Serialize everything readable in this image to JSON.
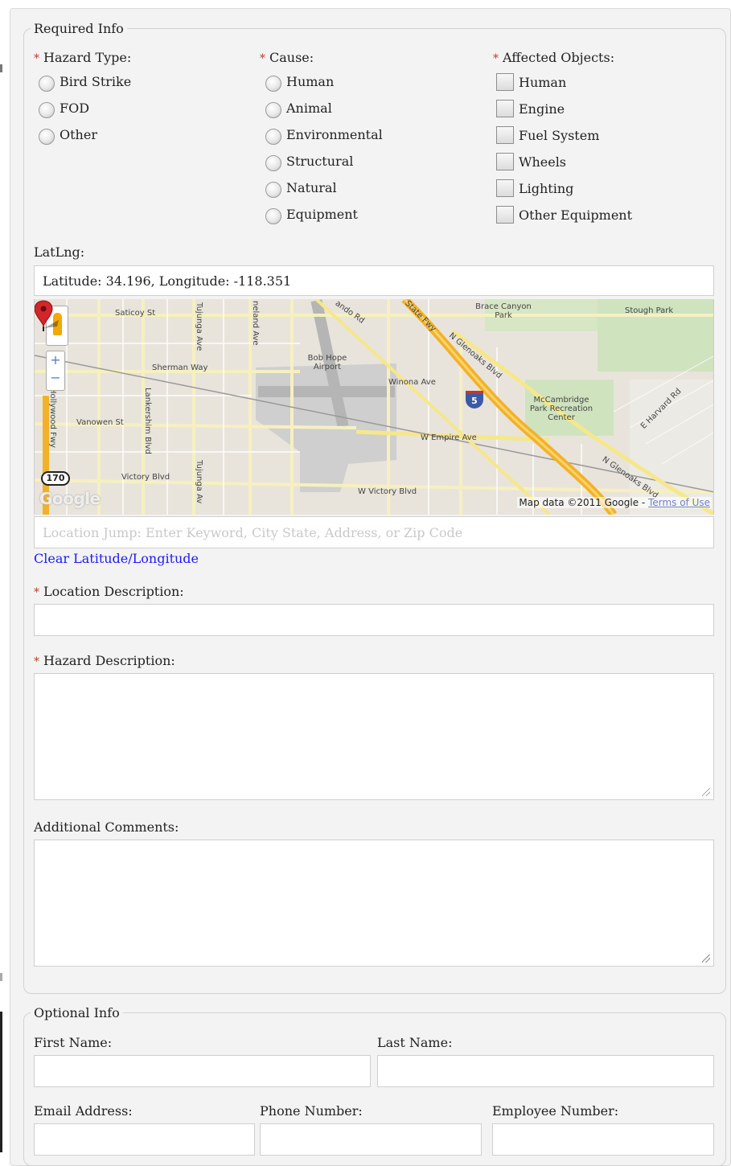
{
  "required": {
    "legend": "Required Info",
    "hazard_type": {
      "label": "Hazard Type:",
      "options": [
        "Bird Strike",
        "FOD",
        "Other"
      ]
    },
    "cause": {
      "label": "Cause:",
      "options": [
        "Human",
        "Animal",
        "Environmental",
        "Structural",
        "Natural",
        "Equipment"
      ]
    },
    "affected_objects": {
      "label": "Affected Objects:",
      "options": [
        "Human",
        "Engine",
        "Fuel System",
        "Wheels",
        "Lighting",
        "Other Equipment"
      ]
    },
    "latlng": {
      "label": "LatLng:",
      "value": "Latitude: 34.196, Longitude: -118.351"
    },
    "map": {
      "labels": {
        "saticoy": "Saticoy St",
        "sherman": "Sherman Way",
        "vanowen": "Vanowen St",
        "victory": "Victory Blvd",
        "w_victory": "W Victory Blvd",
        "w_empire": "W Empire Ave",
        "winona": "Winona Ave",
        "airport": "Bob Hope Airport",
        "mccambridge": "McCambridge Park Recreation Center",
        "brace": "Brace Canyon Park",
        "stough": "Stough Park",
        "glenoaks_n": "N Glenoaks Blvd",
        "glenoaks_n2": "N Glenoaks Blvd",
        "harvard": "E Harvard Rd",
        "state_fwy": "State Fwy",
        "lankershim": "Lankershim Blvd",
        "tujunga": "Tujunga Ave",
        "tujunga2": "Tujunga Av",
        "hollywood": "Hollywood Fwy",
        "cleveland": "neland Ave",
        "fernando": "ando Rd",
        "hwy170": "170",
        "i5": "5",
        "google": "Google"
      },
      "attribution": "Map data ©2011 Google - ",
      "terms": "Terms of Use"
    },
    "location_jump": {
      "placeholder": "Location Jump: Enter Keyword, City State, Address, or Zip Code"
    },
    "clear_link": "Clear Latitude/Longitude",
    "location_description": {
      "label": "Location Description:",
      "value": ""
    },
    "hazard_description": {
      "label": "Hazard Description:",
      "value": ""
    },
    "additional_comments": {
      "label": "Additional Comments:",
      "value": ""
    }
  },
  "optional": {
    "legend": "Optional Info",
    "first_name": {
      "label": "First Name:",
      "value": ""
    },
    "last_name": {
      "label": "Last Name:",
      "value": ""
    },
    "email": {
      "label": "Email Address:",
      "value": ""
    },
    "phone": {
      "label": "Phone Number:",
      "value": ""
    },
    "employee_number": {
      "label": "Employee Number:",
      "value": ""
    }
  },
  "colors": {
    "required_star": "#c0392b",
    "link": "#1a1aff",
    "panel_bg": "#f3f3f3"
  }
}
